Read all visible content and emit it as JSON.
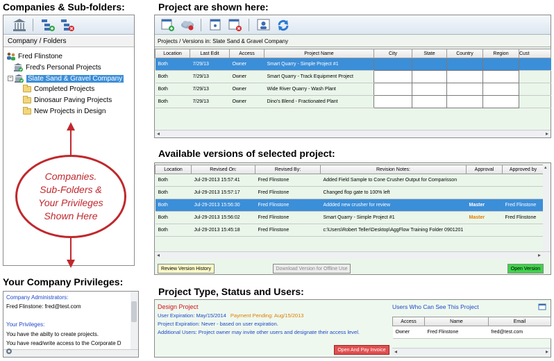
{
  "headings": {
    "companies": "Companies & Sub-folders:",
    "projects": "Project are shown here:",
    "versions": "Available versions of selected project:",
    "privileges": "Your Company Privileges:",
    "project_type": "Project Type, Status and Users:"
  },
  "tree": {
    "header": "Company / Folders",
    "root": "Fred Flinstone",
    "items": [
      {
        "label": "Fred's Personal Projects",
        "icon": "building-check-icon"
      },
      {
        "label": "Slate Sand & Gravel Company",
        "icon": "building-check-icon",
        "selected": true
      },
      {
        "label": "Completed Projects",
        "icon": "folder-icon"
      },
      {
        "label": "Dinosaur Paving Projects",
        "icon": "folder-icon"
      },
      {
        "label": "New Projects in Design",
        "icon": "folder-icon"
      }
    ]
  },
  "callout": {
    "line1": "Companies.",
    "line2": "Sub-Folders &",
    "line3": "Your Privileges",
    "line4": "Shown Here"
  },
  "projects": {
    "caption": "Projects / Versions in: Slate Sand & Gravel Company",
    "columns": [
      "Location",
      "Last Edit",
      "Access",
      "Project Name",
      "City",
      "State",
      "Country",
      "Region",
      "Cust"
    ],
    "rows": [
      [
        "Both",
        "7/29/13",
        "Owner",
        "Smart Quarry - Simple Project #1",
        "",
        "",
        "",
        "",
        ""
      ],
      [
        "Both",
        "7/29/13",
        "Owner",
        "Smart Quarry - Track Equipment Project",
        "",
        "",
        "",
        "",
        ""
      ],
      [
        "Both",
        "7/29/13",
        "Owner",
        "Wide River Quarry - Wash Plant",
        "",
        "",
        "",
        "",
        ""
      ],
      [
        "Both",
        "7/29/13",
        "Owner",
        "Dino's Blend - Fractionated Plant",
        "",
        "",
        "",
        "",
        ""
      ]
    ]
  },
  "versions": {
    "columns": [
      "Location",
      "Revised On:",
      "Revised By:",
      "Revision Notes:",
      "Approval",
      "Approved by"
    ],
    "rows": [
      [
        "Both",
        "Jul-29-2013 15:57:41",
        "Fred Flinstone",
        "Added Field Sample to Cone Crusher Output for Comparisson",
        "",
        ""
      ],
      [
        "Both",
        "Jul-29-2013 15:57:17",
        "Fred Flinstone",
        "Changed flop gate to 100% left",
        "",
        ""
      ],
      [
        "Both",
        "Jul-29-2013 15:56:30",
        "Fred Flinstone",
        "Addded new crusher for review",
        "Master",
        "Fred Flinstone"
      ],
      [
        "Both",
        "Jul-29-2013 15:56:02",
        "Fred Flinstone",
        "Smart Quarry - Simple Project #1",
        "Master",
        "Fred Flinstone"
      ],
      [
        "Both",
        "Jul-29-2013 15:45:18",
        "Fred Flinstone",
        "c:\\Users\\Robert Teller\\Desktop\\AggFlow Training Folder 0901201",
        "",
        ""
      ]
    ],
    "buttons": {
      "review": "Review Version History",
      "download": "Download Version for Offline Use",
      "open": "Open Version"
    }
  },
  "privileges": {
    "admins_label": "Company Administrators:",
    "admin_line": "Fred Flinstone:  fred@test.com",
    "privs_label": "Your Privileges:",
    "line1": "You have the abilty to create projects.",
    "line2": "You have read/write access to the Corporate D"
  },
  "project_type": {
    "title": "Design Project",
    "user_exp_label": "User Expiration:",
    "user_exp_value": "May/15/2014",
    "payment": "Payment Pending: Aug/15/2013",
    "proj_exp": "Project Expiration:  Never  - based on user expiration.",
    "additional": "Additional Users:  Project owner may invite other users and designate their access level.",
    "pay_button": "Open And Pay Invoice",
    "users_title": "Users Who Can See This Project",
    "user_columns": [
      "Access",
      "Name",
      "Email"
    ],
    "user_rows": [
      [
        "Owner",
        "Fred Flinstone",
        "fred@test.com"
      ]
    ]
  },
  "colors": {
    "selection": "#3b8ed8",
    "accent_blue": "#1f47c8",
    "orange": "#e07b00",
    "callout_red": "#c0282d",
    "panel_green": "#eef8ee"
  }
}
